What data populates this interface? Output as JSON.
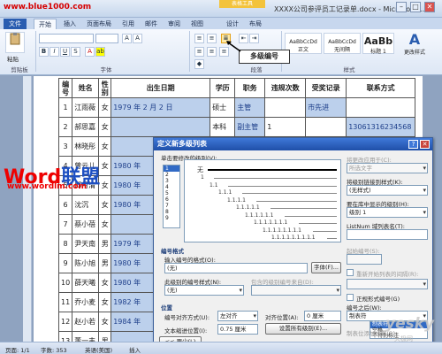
{
  "watermark_top": "www.blue1000.com",
  "window": {
    "title": "XXXX公司参评员工记录单.docx - Microsoft ...",
    "context_tab": "表格工具",
    "min": "–",
    "max": "□",
    "close": "✕"
  },
  "tabs": [
    "文件",
    "开始",
    "插入",
    "页面布局",
    "引用",
    "邮件",
    "审阅",
    "视图",
    "设计",
    "布局"
  ],
  "ribbon": {
    "paste": "粘贴",
    "clipboard": "剪贴板",
    "font_group": "字体",
    "paragraph_group": "段落",
    "styles_group": "样式",
    "change_styles": "更改样式",
    "style_items": [
      {
        "preview": "AaBbCcDd",
        "name": "正文"
      },
      {
        "preview": "AaBbCcDd",
        "name": "无间隔"
      },
      {
        "preview": "AaBb",
        "name": "标题 1"
      }
    ],
    "tooltip": "多级编号"
  },
  "table": {
    "headers": [
      "编号",
      "姓名",
      "性别",
      "出生日期",
      "学历",
      "职务",
      "违规次数",
      "受奖记录",
      "联系方式"
    ],
    "rows": [
      [
        "1",
        "江雨薇",
        "女",
        "1979 年 2 月 2 日",
        "硕士",
        "主管",
        "",
        "市先进",
        ""
      ],
      [
        "2",
        "郝思嘉",
        "女",
        "",
        "本科",
        "副主管",
        "1",
        "",
        "13061316234568"
      ],
      [
        "3",
        "林晓彤",
        "女",
        "",
        "",
        "",
        "",
        "",
        ""
      ],
      [
        "4",
        "曾云儿",
        "女",
        "1980 年",
        "",
        "",
        "",
        "",
        ""
      ],
      [
        "5",
        "邱月清",
        "女",
        "1980 年",
        "",
        "",
        "",
        "",
        ""
      ],
      [
        "6",
        "沈沉",
        "女",
        "1980 年",
        "",
        "",
        "",
        "",
        ""
      ],
      [
        "7",
        "蔡小蓓",
        "女",
        "",
        "",
        "",
        "",
        "",
        ""
      ],
      [
        "8",
        "尹天南",
        "男",
        "1979 年",
        "",
        "",
        "",
        "",
        ""
      ],
      [
        "9",
        "陈小旭",
        "男",
        "1980 年",
        "",
        "",
        "",
        "",
        ""
      ],
      [
        "10",
        "薛天曦",
        "女",
        "1980 年",
        "",
        "",
        "",
        "",
        ""
      ],
      [
        "11",
        "乔小麦",
        "女",
        "1982 年",
        "",
        "",
        "",
        "",
        ""
      ],
      [
        "12",
        "赵小若",
        "女",
        "1984 年",
        "",
        "",
        "",
        "",
        ""
      ],
      [
        "13",
        "董一韦",
        "男",
        "",
        "",
        "",
        "",
        "",
        ""
      ]
    ]
  },
  "logo": {
    "word_red": "Word",
    "word_blue": "联盟",
    "url": "www.wordlm.com"
  },
  "dialog": {
    "title": "定义新多级列表",
    "help": "?",
    "close": "✕",
    "click_level_label": "单击要修改的级别(V):",
    "levels": [
      "1",
      "2",
      "3",
      "4",
      "5",
      "6",
      "7",
      "8",
      "9"
    ],
    "preview_none": "无",
    "preview_nums": [
      "1",
      "1.1",
      "1.1.1",
      "1.1.1.1",
      "1.1.1.1.1",
      "1.1.1.1.1.1",
      "1.1.1.1.1.1.1",
      "1.1.1.1.1.1.1.1",
      "1.1.1.1.1.1.1.1.1"
    ],
    "apply_changes_label": "将更改应用于(C):",
    "apply_changes_value": "所选文字",
    "link_style_label": "将级别链接到样式(K):",
    "link_style_value": "(无样式)",
    "gallery_level_label": "要在库中显示的级别(H):",
    "gallery_level_value": "级别 1",
    "listnum_label": "ListNum 域列表名(T):",
    "number_format_section": "编号格式",
    "enter_format_label": "输入编号的格式(O):",
    "enter_format_value": "(无)",
    "font_button": "字体(F)...",
    "number_style_label": "此级别的编号样式(N):",
    "number_style_value": "(无)",
    "include_level_label": "包含的级别编号来自(D):",
    "start_at_label": "起始编号(S):",
    "restart_label": "重新开始列表的间隔(R):",
    "legal_label": "正规形式编号(G)",
    "position_section": "位置",
    "alignment_label": "编号对齐方式(U):",
    "alignment_value": "左对齐",
    "aligned_at_label": "对齐位置(A):",
    "aligned_at_value": "0 厘米",
    "follow_with_label": "编号之后(W):",
    "follow_with_value": "制表符",
    "follow_options": [
      "制表符",
      "空格",
      "不特别标注"
    ],
    "text_indent_label": "文本缩进位置(I):",
    "text_indent_value": "0.75 厘米",
    "set_all_button": "设置所有级别(E)...",
    "tab_stop_label": "制表位添加位置(B):",
    "less_button": "<< 更少(L)",
    "ok_button": "确定",
    "cancel_button": "取消"
  },
  "statusbar": {
    "page": "页面: 1/1",
    "words": "字数: 353",
    "lang": "英语(美国)",
    "mode": "插入"
  },
  "watermark_bottom": {
    "main": "yesky",
    "sub": "天极网"
  }
}
